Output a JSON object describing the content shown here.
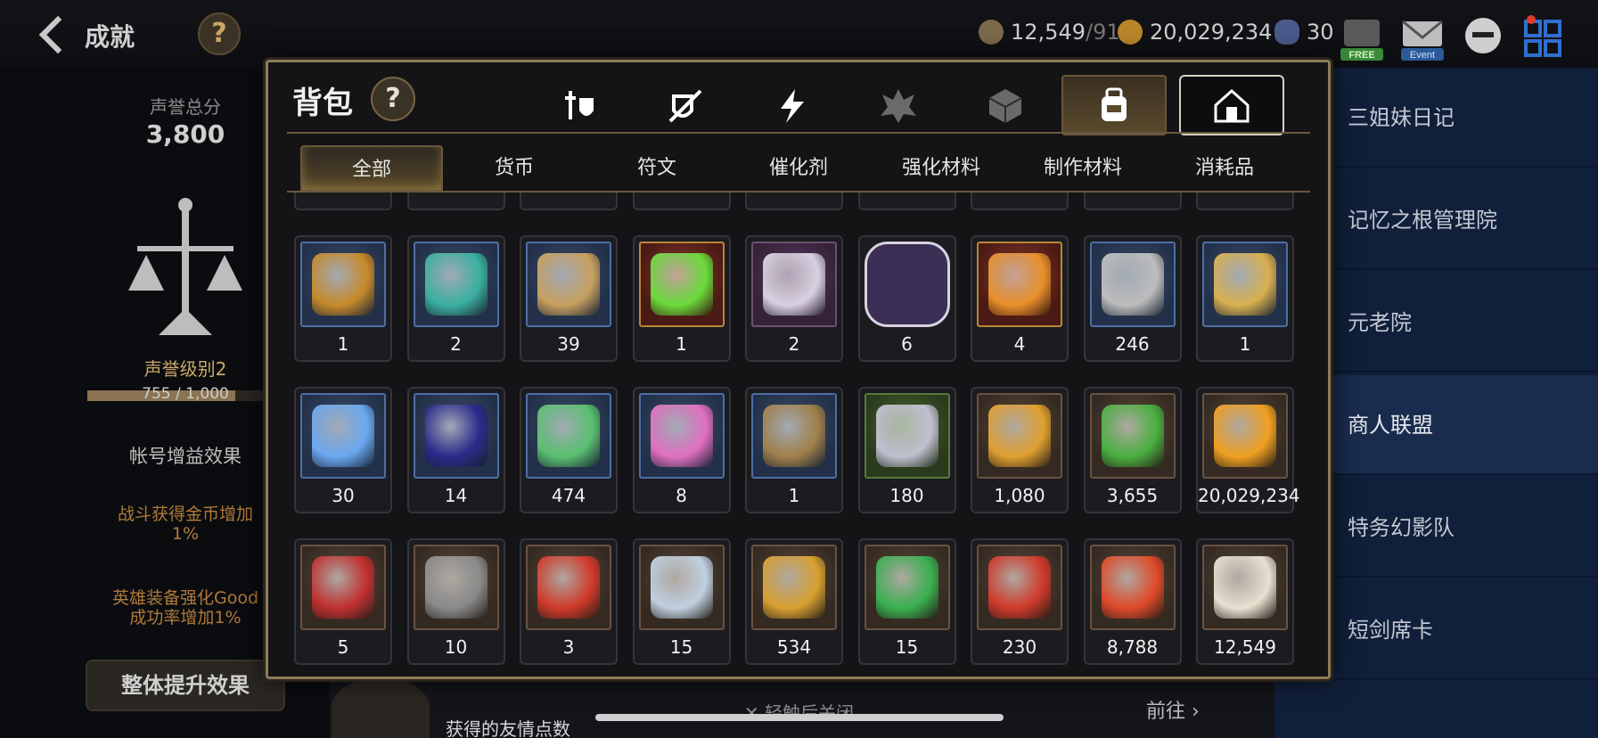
{
  "header": {
    "title": "成就",
    "help": "?",
    "resources": [
      {
        "icon": "horse-token-icon",
        "value": "12,549",
        "suffix": "/91"
      },
      {
        "icon": "gold-coin-icon",
        "value": "20,029,234",
        "suffix": ""
      },
      {
        "icon": "crystal-icon",
        "value": "30",
        "suffix": ""
      }
    ],
    "free_label": "FREE",
    "event_label": "Event"
  },
  "left_panel": {
    "reputation_title": "声誉总分",
    "reputation_value": "3,800",
    "level_label": "声誉级别2",
    "progress_text": "755 / 1,000",
    "progress_fraction": 0.755,
    "bonus_title": "帐号增益效果",
    "bonus_1": "战斗获得金币增加\n1%",
    "bonus_2": "英雄装备强化Good\n成功率增加1%",
    "button": "整体提升效果"
  },
  "right_list": [
    "三姐妹日记",
    "记忆之根管理院",
    "元老院",
    "商人联盟",
    "特务幻影队",
    "短剑席卡"
  ],
  "right_list_active": 3,
  "bottom": {
    "friend_text": "获得的友情点数",
    "close_hint": "✕ 轻触后关闭",
    "goto": "前往"
  },
  "modal": {
    "title": "背包",
    "help": "?",
    "category_icons": [
      "weapon-armor-icon",
      "sword-shield-icon",
      "lightning-icon",
      "spiky-crest-icon",
      "cube-icon",
      "backpack-icon",
      "house-icon"
    ],
    "active_category": 5,
    "sub_tabs": [
      "全部",
      "货币",
      "符文",
      "催化剂",
      "强化材料",
      "制作材料",
      "消耗品"
    ],
    "active_sub_tab": 0,
    "rows": [
      [
        {
          "icon": "amber-leaf-crest-icon",
          "frame": "blue",
          "qty": "1"
        },
        {
          "icon": "teal-gem-icon",
          "frame": "blue",
          "qty": "2"
        },
        {
          "icon": "ginseng-root-icon",
          "frame": "blue",
          "qty": "39"
        },
        {
          "icon": "green-potion-cauldron-icon",
          "frame": "red",
          "qty": "1"
        },
        {
          "icon": "feather-wand-icon",
          "frame": "purple",
          "qty": "2"
        },
        {
          "icon": "pet-food-bag-icon",
          "frame": "hex",
          "qty": "6"
        },
        {
          "icon": "fire-crystal-icon",
          "frame": "red",
          "qty": "4"
        },
        {
          "icon": "silver-coin-icon",
          "frame": "blue",
          "qty": "246"
        },
        {
          "icon": "star-amulet-icon",
          "frame": "blue",
          "qty": "1"
        }
      ],
      [
        {
          "icon": "blue-crystal-icon",
          "frame": "blue",
          "qty": "30"
        },
        {
          "icon": "certificate-card-icon",
          "frame": "blue",
          "qty": "14"
        },
        {
          "icon": "green-leaf-icon",
          "frame": "blue",
          "qty": "474"
        },
        {
          "icon": "pink-crystal-cluster-icon",
          "frame": "blue",
          "qty": "8"
        },
        {
          "icon": "bronze-key-icon",
          "frame": "blue",
          "qty": "1"
        },
        {
          "icon": "fist-emblem-icon",
          "frame": "green",
          "qty": "180"
        },
        {
          "icon": "sword-hexagon-medal-icon",
          "frame": "brown",
          "qty": "1,080"
        },
        {
          "icon": "green-heart-icon",
          "frame": "brown",
          "qty": "3,655"
        },
        {
          "icon": "gold-sun-coin-icon",
          "frame": "brown",
          "qty": "20,029,234"
        }
      ],
      [
        {
          "icon": "war-banner-icon",
          "frame": "brown",
          "qty": "5"
        },
        {
          "icon": "stone-cube-icon",
          "frame": "brown",
          "qty": "10"
        },
        {
          "icon": "red-seal-icon",
          "frame": "brown",
          "qty": "3"
        },
        {
          "icon": "robot-companion-icon",
          "frame": "brown",
          "qty": "15"
        },
        {
          "icon": "gold-fist-badge-icon",
          "frame": "brown",
          "qty": "534"
        },
        {
          "icon": "clover-icon",
          "frame": "brown",
          "qty": "15"
        },
        {
          "icon": "red-bracelet-icon",
          "frame": "brown",
          "qty": "230"
        },
        {
          "icon": "red-leaf-rune-icon",
          "frame": "brown",
          "qty": "8,788"
        },
        {
          "icon": "silver-horse-icon",
          "frame": "brown",
          "qty": "12,549"
        }
      ]
    ],
    "colors": {
      "gold_border": "#8d7b5c",
      "blue_frame": "#4d6fa6",
      "brown_frame": "#6a5240",
      "red_frame": "#b8863a"
    }
  }
}
